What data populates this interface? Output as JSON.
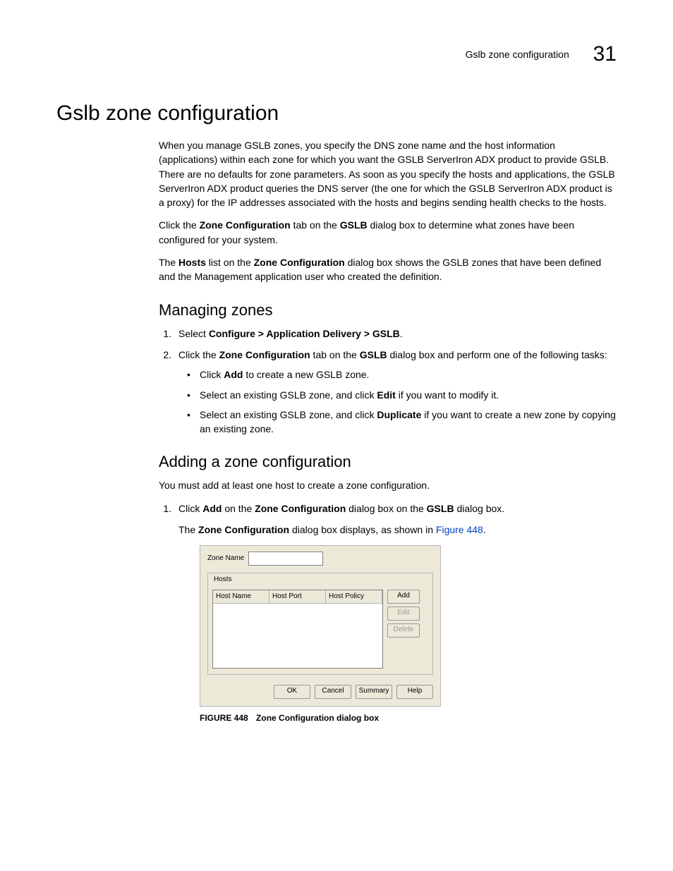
{
  "header": {
    "running_title": "Gslb zone configuration",
    "chapter_number": "31"
  },
  "h1": "Gslb zone configuration",
  "intro_p1": "When you manage GSLB zones, you specify the DNS zone name and the host information (applications) within each zone for which you want the GSLB ServerIron ADX product to provide GSLB. There are no defaults for zone parameters. As soon as you specify the hosts and applications, the GSLB ServerIron ADX product queries the DNS server (the one for which the GSLB ServerIron ADX product is a proxy) for the IP addresses associated with the hosts and begins sending health checks to the hosts.",
  "intro_p2_pre": "Click the ",
  "intro_p2_b1": "Zone Configuration",
  "intro_p2_mid": " tab on the ",
  "intro_p2_b2": "GSLB",
  "intro_p2_post": " dialog box to determine what zones have been configured for your system.",
  "intro_p3_pre": "The ",
  "intro_p3_b1": "Hosts",
  "intro_p3_mid1": " list on the ",
  "intro_p3_b2": "Zone Configuration",
  "intro_p3_post": " dialog box shows the GSLB zones that have been defined and the Management application user who created the definition.",
  "h2_managing": "Managing zones",
  "step1_pre": "Select ",
  "step1_b": "Configure > Application Delivery > GSLB",
  "step1_post": ".",
  "step2_pre": "Click the ",
  "step2_b1": "Zone Configuration",
  "step2_mid": " tab on the ",
  "step2_b2": "GSLB",
  "step2_post": " dialog box and perform one of the following tasks:",
  "bullet1_pre": "Click ",
  "bullet1_b": "Add",
  "bullet1_post": " to create a new GSLB zone.",
  "bullet2_pre": "Select an existing GSLB zone, and click ",
  "bullet2_b": "Edit",
  "bullet2_post": " if you want to modify it.",
  "bullet3_pre": "Select an existing GSLB zone, and click ",
  "bullet3_b": "Duplicate",
  "bullet3_post": " if you want to create a new zone by copying an existing zone.",
  "h2_adding": "Adding a zone configuration",
  "adding_p1": "You must add at least one host to create a zone configuration.",
  "adding_step1_pre": "Click ",
  "adding_step1_b1": "Add",
  "adding_step1_mid1": " on the ",
  "adding_step1_b2": "Zone Configuration",
  "adding_step1_mid2": " dialog box on the ",
  "adding_step1_b3": "GSLB",
  "adding_step1_post": " dialog box.",
  "adding_step1_sub_pre": "The ",
  "adding_step1_sub_b": "Zone Configuration",
  "adding_step1_sub_mid": " dialog box displays, as shown in ",
  "adding_step1_sub_link": "Figure 448",
  "adding_step1_sub_post": ".",
  "dialog": {
    "zone_name_label": "Zone Name",
    "hosts_legend": "Hosts",
    "col_hostname": "Host Name",
    "col_hostport": "Host Port",
    "col_hostpolicy": "Host Policy",
    "btn_add": "Add",
    "btn_edit": "Edit",
    "btn_delete": "Delete",
    "btn_ok": "OK",
    "btn_cancel": "Cancel",
    "btn_summary": "Summary",
    "btn_help": "Help"
  },
  "figure": {
    "number": "FIGURE 448",
    "title": "Zone Configuration dialog box"
  }
}
